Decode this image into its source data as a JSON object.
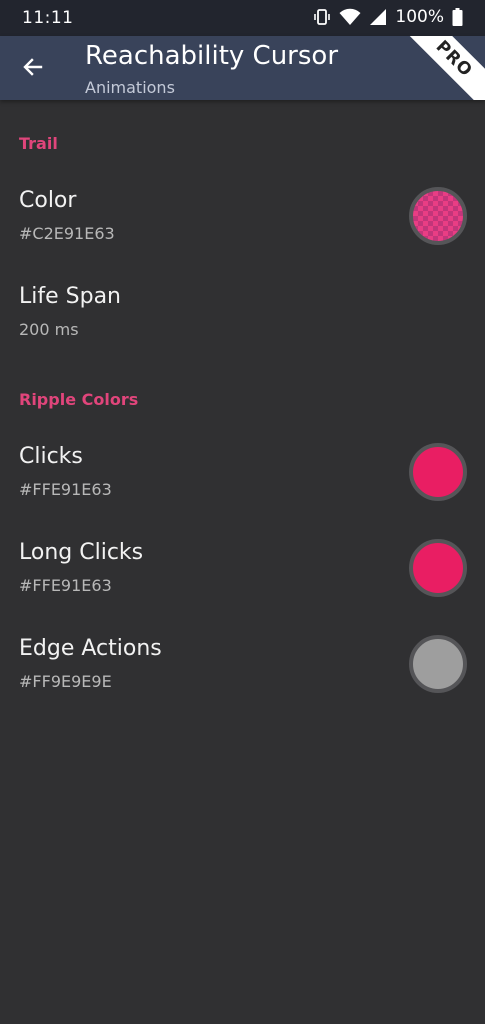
{
  "status_bar": {
    "time": "11:11",
    "battery": "100%"
  },
  "app_bar": {
    "title": "Reachability Cursor",
    "subtitle": "Animations",
    "badge": "PRO"
  },
  "sections": {
    "trail": {
      "header": "Trail",
      "color": {
        "title": "Color",
        "summary": "#C2E91E63",
        "swatch_color": "#E91E63",
        "swatch_alpha": "C2"
      },
      "life_span": {
        "title": "Life Span",
        "summary": "200 ms"
      }
    },
    "ripple_colors": {
      "header": "Ripple Colors",
      "clicks": {
        "title": "Clicks",
        "summary": "#FFE91E63",
        "swatch_color": "#E91E63"
      },
      "long_clicks": {
        "title": "Long Clicks",
        "summary": "#FFE91E63",
        "swatch_color": "#E91E63"
      },
      "edge_actions": {
        "title": "Edge Actions",
        "summary": "#FF9E9E9E",
        "swatch_color": "#9E9E9E"
      }
    }
  }
}
